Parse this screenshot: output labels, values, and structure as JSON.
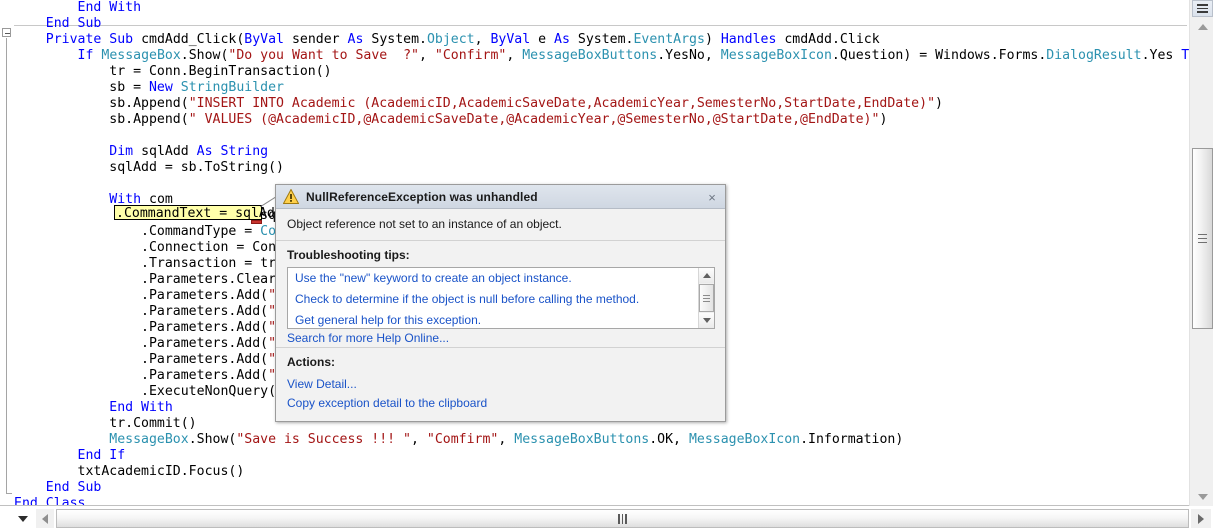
{
  "editor": {
    "name": "visual-studio-code-editor",
    "language": "vb",
    "lines": [
      {
        "indent": 8,
        "html": "<span class=\"kw\">End With</span>"
      },
      {
        "indent": 4,
        "html": "<span class=\"kw\">End Sub</span>"
      },
      {
        "indent": 4,
        "html": "<span class=\"kw\">Private Sub</span> <span class=\"pln\">cmdAdd_Click(</span><span class=\"kw\">ByVal</span> <span class=\"pln\">sender</span> <span class=\"kw\">As</span> <span class=\"pln\">System.</span><span class=\"typ\">Object</span><span class=\"pln\">, </span><span class=\"kw\">ByVal</span> <span class=\"pln\">e</span> <span class=\"kw\">As</span> <span class=\"pln\">System.</span><span class=\"typ\">EventArgs</span><span class=\"pln\">) </span><span class=\"kw\">Handles</span> <span class=\"pln\">cmdAdd.Click</span>"
      },
      {
        "indent": 8,
        "html": "<span class=\"kw\">If</span> <span class=\"typ\">MessageBox</span><span class=\"pln\">.Show(</span><span class=\"str\">\"Do you Want to Save  ?\"</span><span class=\"pln\">, </span><span class=\"str\">\"Confirm\"</span><span class=\"pln\">, </span><span class=\"typ\">MessageBoxButtons</span><span class=\"pln\">.YesNo, </span><span class=\"typ\">MessageBoxIcon</span><span class=\"pln\">.Question) = Windows.Forms.</span><span class=\"typ\">DialogResult</span><span class=\"pln\">.Yes </span><span class=\"kw\">Then</span>"
      },
      {
        "indent": 12,
        "html": "<span class=\"pln\">tr = Conn.BeginTransaction()</span>"
      },
      {
        "indent": 12,
        "html": "<span class=\"pln\">sb = </span><span class=\"kw\">New</span> <span class=\"typ\">StringBuilder</span>"
      },
      {
        "indent": 12,
        "html": "<span class=\"pln\">sb.Append(</span><span class=\"str\">\"INSERT INTO Academic (AcademicID,AcademicSaveDate,AcademicYear,SemesterNo,StartDate,EndDate)\"</span><span class=\"pln\">)</span>"
      },
      {
        "indent": 12,
        "html": "<span class=\"pln\">sb.Append(</span><span class=\"str\">\" VALUES (@AcademicID,@AcademicSaveDate,@AcademicYear,@SemesterNo,@StartDate,@EndDate)\"</span><span class=\"pln\">)</span>"
      },
      {
        "indent": 0,
        "html": ""
      },
      {
        "indent": 12,
        "html": "<span class=\"kw\">Dim</span> <span class=\"pln\">sqlAdd</span> <span class=\"kw\">As String</span>"
      },
      {
        "indent": 12,
        "html": "<span class=\"pln\">sqlAdd = sb.ToString()</span>"
      },
      {
        "indent": 0,
        "html": ""
      },
      {
        "indent": 12,
        "html": "<span class=\"kw\">With</span> <span class=\"pln\">com</span>"
      },
      {
        "indent": 16,
        "html": "<span class=\"pln\">.CommandText = sqlAdd</span>"
      },
      {
        "indent": 16,
        "html": "<span class=\"pln\">.CommandType = </span><span class=\"typ\">CommandType</span><span class=\"pln\">.Text</span>"
      },
      {
        "indent": 16,
        "html": "<span class=\"pln\">.Connection = Conn</span>"
      },
      {
        "indent": 16,
        "html": "<span class=\"pln\">.Transaction = tr</span>"
      },
      {
        "indent": 16,
        "html": "<span class=\"pln\">.Parameters.Clear()</span>"
      },
      {
        "indent": 16,
        "html": "<span class=\"pln\">.Parameters.Add(</span><span class=\"str\">\"@AcademicID\"</span><span class=\"pln\">, txtAcademicID.Text)</span>"
      },
      {
        "indent": 16,
        "html": "<span class=\"pln\">.Parameters.Add(</span><span class=\"str\">\"@AcademicSaveDate\"</span><span class=\"pln\">, dtpSave.Value)</span>"
      },
      {
        "indent": 16,
        "html": "<span class=\"pln\">.Parameters.Add(</span><span class=\"str\">\"@AcademicYear\"</span><span class=\"pln\">, txtYear.Text)</span>"
      },
      {
        "indent": 16,
        "html": "<span class=\"pln\">.Parameters.Add(</span><span class=\"str\">\"@SemesterNo\"</span><span class=\"pln\">, cboSemester.Text)</span>"
      },
      {
        "indent": 16,
        "html": "<span class=\"pln\">.Parameters.Add(</span><span class=\"str\">\"@StartDate\"</span><span class=\"pln\">, dtpStart.Value)</span>"
      },
      {
        "indent": 16,
        "html": "<span class=\"pln\">.Parameters.Add(</span><span class=\"str\">\"@EndDate\"</span><span class=\"pln\">, dtpEnd.Value)</span>"
      },
      {
        "indent": 16,
        "html": "<span class=\"pln\">.ExecuteNonQuery()</span>"
      },
      {
        "indent": 12,
        "html": "<span class=\"kw\">End With</span>"
      },
      {
        "indent": 12,
        "html": "<span class=\"pln\">tr.Commit()</span>"
      },
      {
        "indent": 12,
        "html": "<span class=\"typ\">MessageBox</span><span class=\"pln\">.Show(</span><span class=\"str\">\"Save is Success !!! \"</span><span class=\"pln\">, </span><span class=\"str\">\"Comfirm\"</span><span class=\"pln\">, </span><span class=\"typ\">MessageBoxButtons</span><span class=\"pln\">.OK, </span><span class=\"typ\">MessageBoxIcon</span><span class=\"pln\">.Information)</span>"
      },
      {
        "indent": 8,
        "html": "<span class=\"kw\">End If</span>"
      },
      {
        "indent": 8,
        "html": "<span class=\"pln\">txtAcademicID.Focus()</span>"
      },
      {
        "indent": 4,
        "html": "<span class=\"kw\">End Sub</span>"
      },
      {
        "indent": 0,
        "html": "<span class=\"kw\">End Class</span>"
      }
    ],
    "highlighted_statement": ".CommandText = sqlAdd",
    "highlight_color": "#ffffaa"
  },
  "exception_dialog": {
    "title": "NullReferenceException was unhandled",
    "icon": "warning-icon",
    "close_label": "×",
    "message": "Object reference not set to an instance of an object.",
    "tips_heading": "Troubleshooting tips:",
    "tips": [
      "Use the \"new\" keyword to create an object instance.",
      "Check to determine if the object is null before calling the method.",
      "Get general help for this exception."
    ],
    "search_more": "Search for more Help Online...",
    "actions_heading": "Actions:",
    "actions": [
      "View Detail...",
      "Copy exception detail to the clipboard"
    ],
    "link_color": "#1a53c8"
  },
  "scrollbars": {
    "vertical_name": "editor-vertical-scrollbar",
    "horizontal_name": "editor-horizontal-scrollbar",
    "splitter_name": "editor-splitter-handle"
  }
}
